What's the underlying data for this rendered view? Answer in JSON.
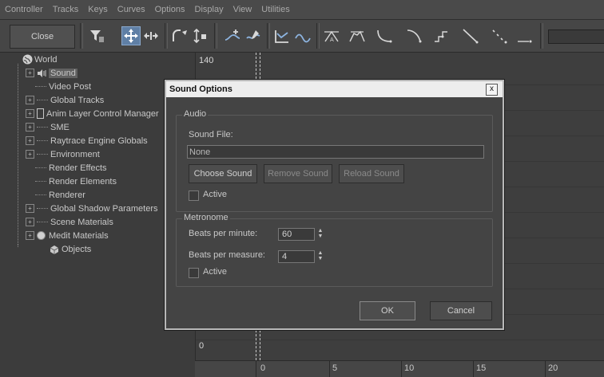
{
  "menu": [
    "Controller",
    "Tracks",
    "Keys",
    "Curves",
    "Options",
    "Display",
    "View",
    "Utilities"
  ],
  "toolbar": {
    "close_label": "Close"
  },
  "tree": {
    "items": [
      {
        "label": "World"
      },
      {
        "label": "Sound"
      },
      {
        "label": "Video Post"
      },
      {
        "label": "Global Tracks"
      },
      {
        "label": "Anim Layer Control Manager"
      },
      {
        "label": "SME"
      },
      {
        "label": "Raytrace Engine Globals"
      },
      {
        "label": "Environment"
      },
      {
        "label": "Render Effects"
      },
      {
        "label": "Render Elements"
      },
      {
        "label": "Renderer"
      },
      {
        "label": "Global Shadow Parameters"
      },
      {
        "label": "Scene Materials"
      },
      {
        "label": "Medit Materials"
      },
      {
        "label": "Objects"
      }
    ]
  },
  "graph": {
    "top_value": "140",
    "bottom_value": "0"
  },
  "timeline": {
    "ticks": [
      "0",
      "5",
      "10",
      "15",
      "20"
    ]
  },
  "dialog": {
    "title": "Sound Options",
    "close_symbol": "x",
    "audio": {
      "group_label": "Audio",
      "sound_file_label": "Sound File:",
      "sound_file_value": "None",
      "choose_label": "Choose Sound",
      "remove_label": "Remove Sound",
      "reload_label": "Reload Sound",
      "active_label": "Active",
      "active_checked": false
    },
    "metronome": {
      "group_label": "Metronome",
      "bpm_label": "Beats per minute:",
      "bpm_value": "60",
      "bpmeasure_label": "Beats per measure:",
      "bpmeasure_value": "4",
      "active_label": "Active",
      "active_checked": false
    },
    "ok_label": "OK",
    "cancel_label": "Cancel"
  },
  "icons": [
    "filter-icon",
    "move-keys-icon",
    "slide-keys-icon",
    "scale-keys-icon",
    "scale-values-icon",
    "add-keys-icon",
    "draw-curves-icon",
    "reduce-keys-icon",
    "tangent-auto-icon",
    "tangent-custom-icon",
    "tangent-fast-icon",
    "tangent-slow-icon",
    "tangent-step-icon",
    "tangent-linear-icon",
    "tangent-smooth-icon"
  ]
}
